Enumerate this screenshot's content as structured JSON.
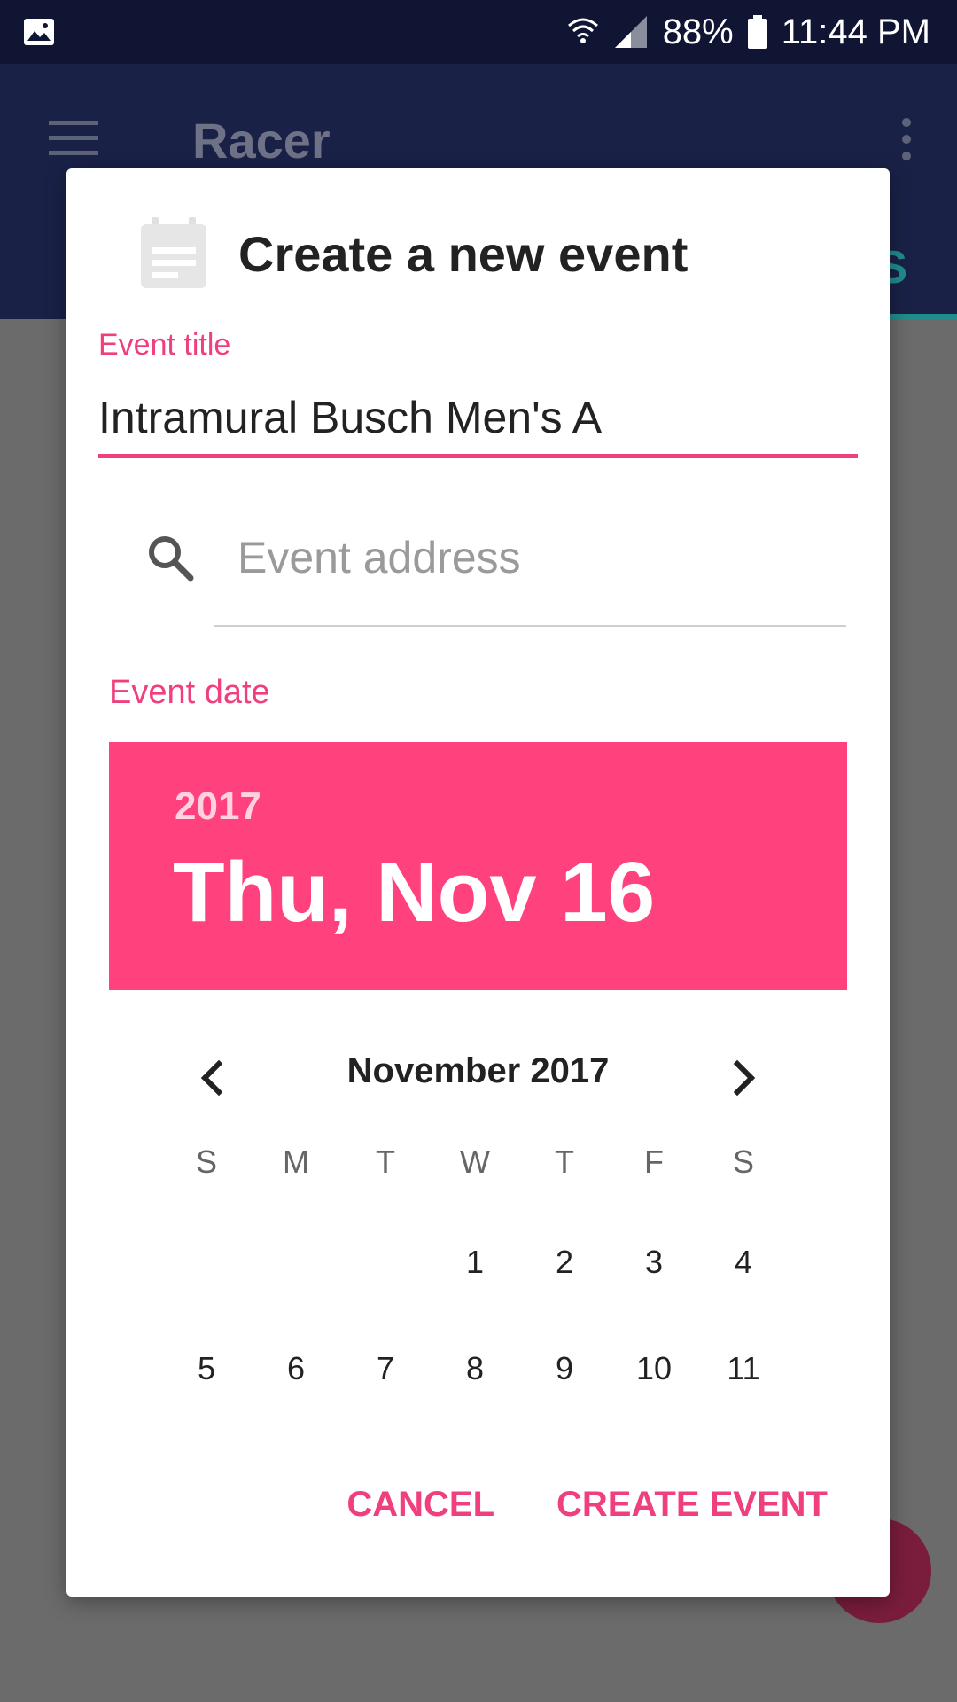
{
  "status_bar": {
    "battery": "88%",
    "time": "11:44 PM"
  },
  "app_bar": {
    "title": "Racer",
    "tab_text": "S"
  },
  "dialog": {
    "title": "Create a new event",
    "event_title_label": "Event title",
    "event_title_value": "Intramural Busch Men's A",
    "address_placeholder": "Event address",
    "event_date_label": "Event date",
    "selected_year": "2017",
    "selected_date": "Thu, Nov 16",
    "month_label": "November 2017",
    "weekdays": [
      "S",
      "M",
      "T",
      "W",
      "T",
      "F",
      "S"
    ],
    "week1": [
      "",
      "",
      "",
      "1",
      "2",
      "3",
      "4"
    ],
    "week2": [
      "5",
      "6",
      "7",
      "8",
      "9",
      "10",
      "11"
    ],
    "cancel_label": "CANCEL",
    "create_label": "CREATE EVENT"
  },
  "colors": {
    "accent": "#ff417e",
    "app_bar": "#1a2147",
    "status_bar": "#0f1533"
  }
}
